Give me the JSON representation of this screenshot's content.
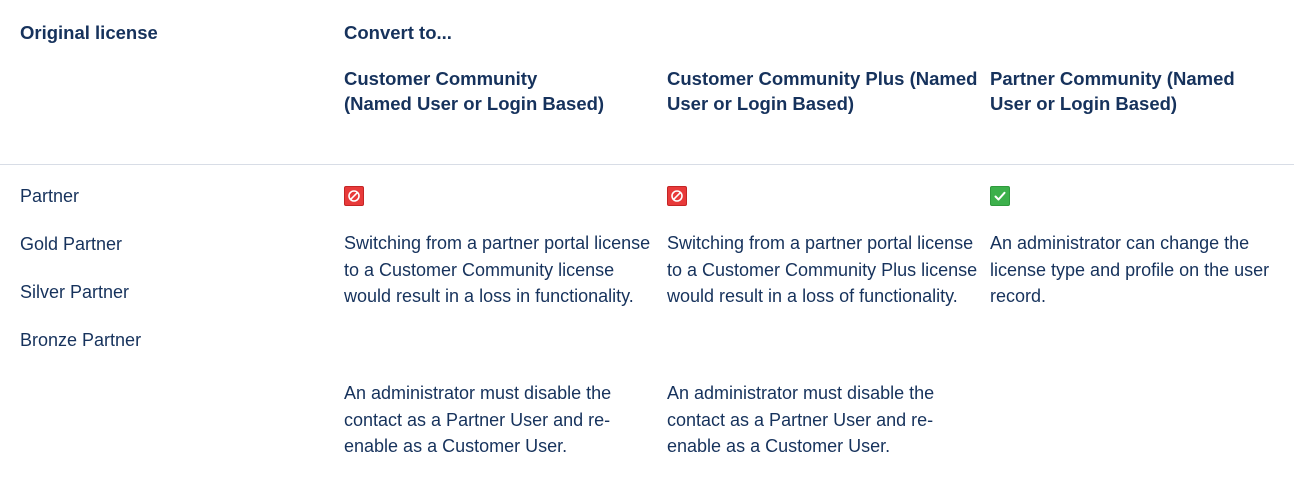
{
  "headers": {
    "original": "Original license",
    "convert_to": "Convert to...",
    "columns": [
      "Customer Community (Named User or Login Based)",
      "Customer Community Plus (Named User or Login Based)",
      "Partner Community (Named User or Login Based)"
    ]
  },
  "licenses": [
    "Partner",
    "Gold Partner",
    "Silver Partner",
    "Bronze Partner"
  ],
  "cells": [
    {
      "status": "not-allowed",
      "icon": "prohibited-icon",
      "color": "#e83a3a",
      "paragraphs": [
        "Switching from a partner portal license to a Customer Community license would result in a loss in functionality.",
        "An administrator must disable the contact as a Partner User and re-enable as a Customer User."
      ]
    },
    {
      "status": "not-allowed",
      "icon": "prohibited-icon",
      "color": "#e83a3a",
      "paragraphs": [
        "Switching from a partner portal license to a Customer Community Plus license would result in a loss of functionality.",
        "An administrator must disable the contact as a Partner User and re-enable as a Customer User."
      ]
    },
    {
      "status": "allowed",
      "icon": "checkmark-icon",
      "color": "#3cb04b",
      "paragraphs": [
        "An administrator can change the license type and profile on the user record."
      ]
    }
  ]
}
